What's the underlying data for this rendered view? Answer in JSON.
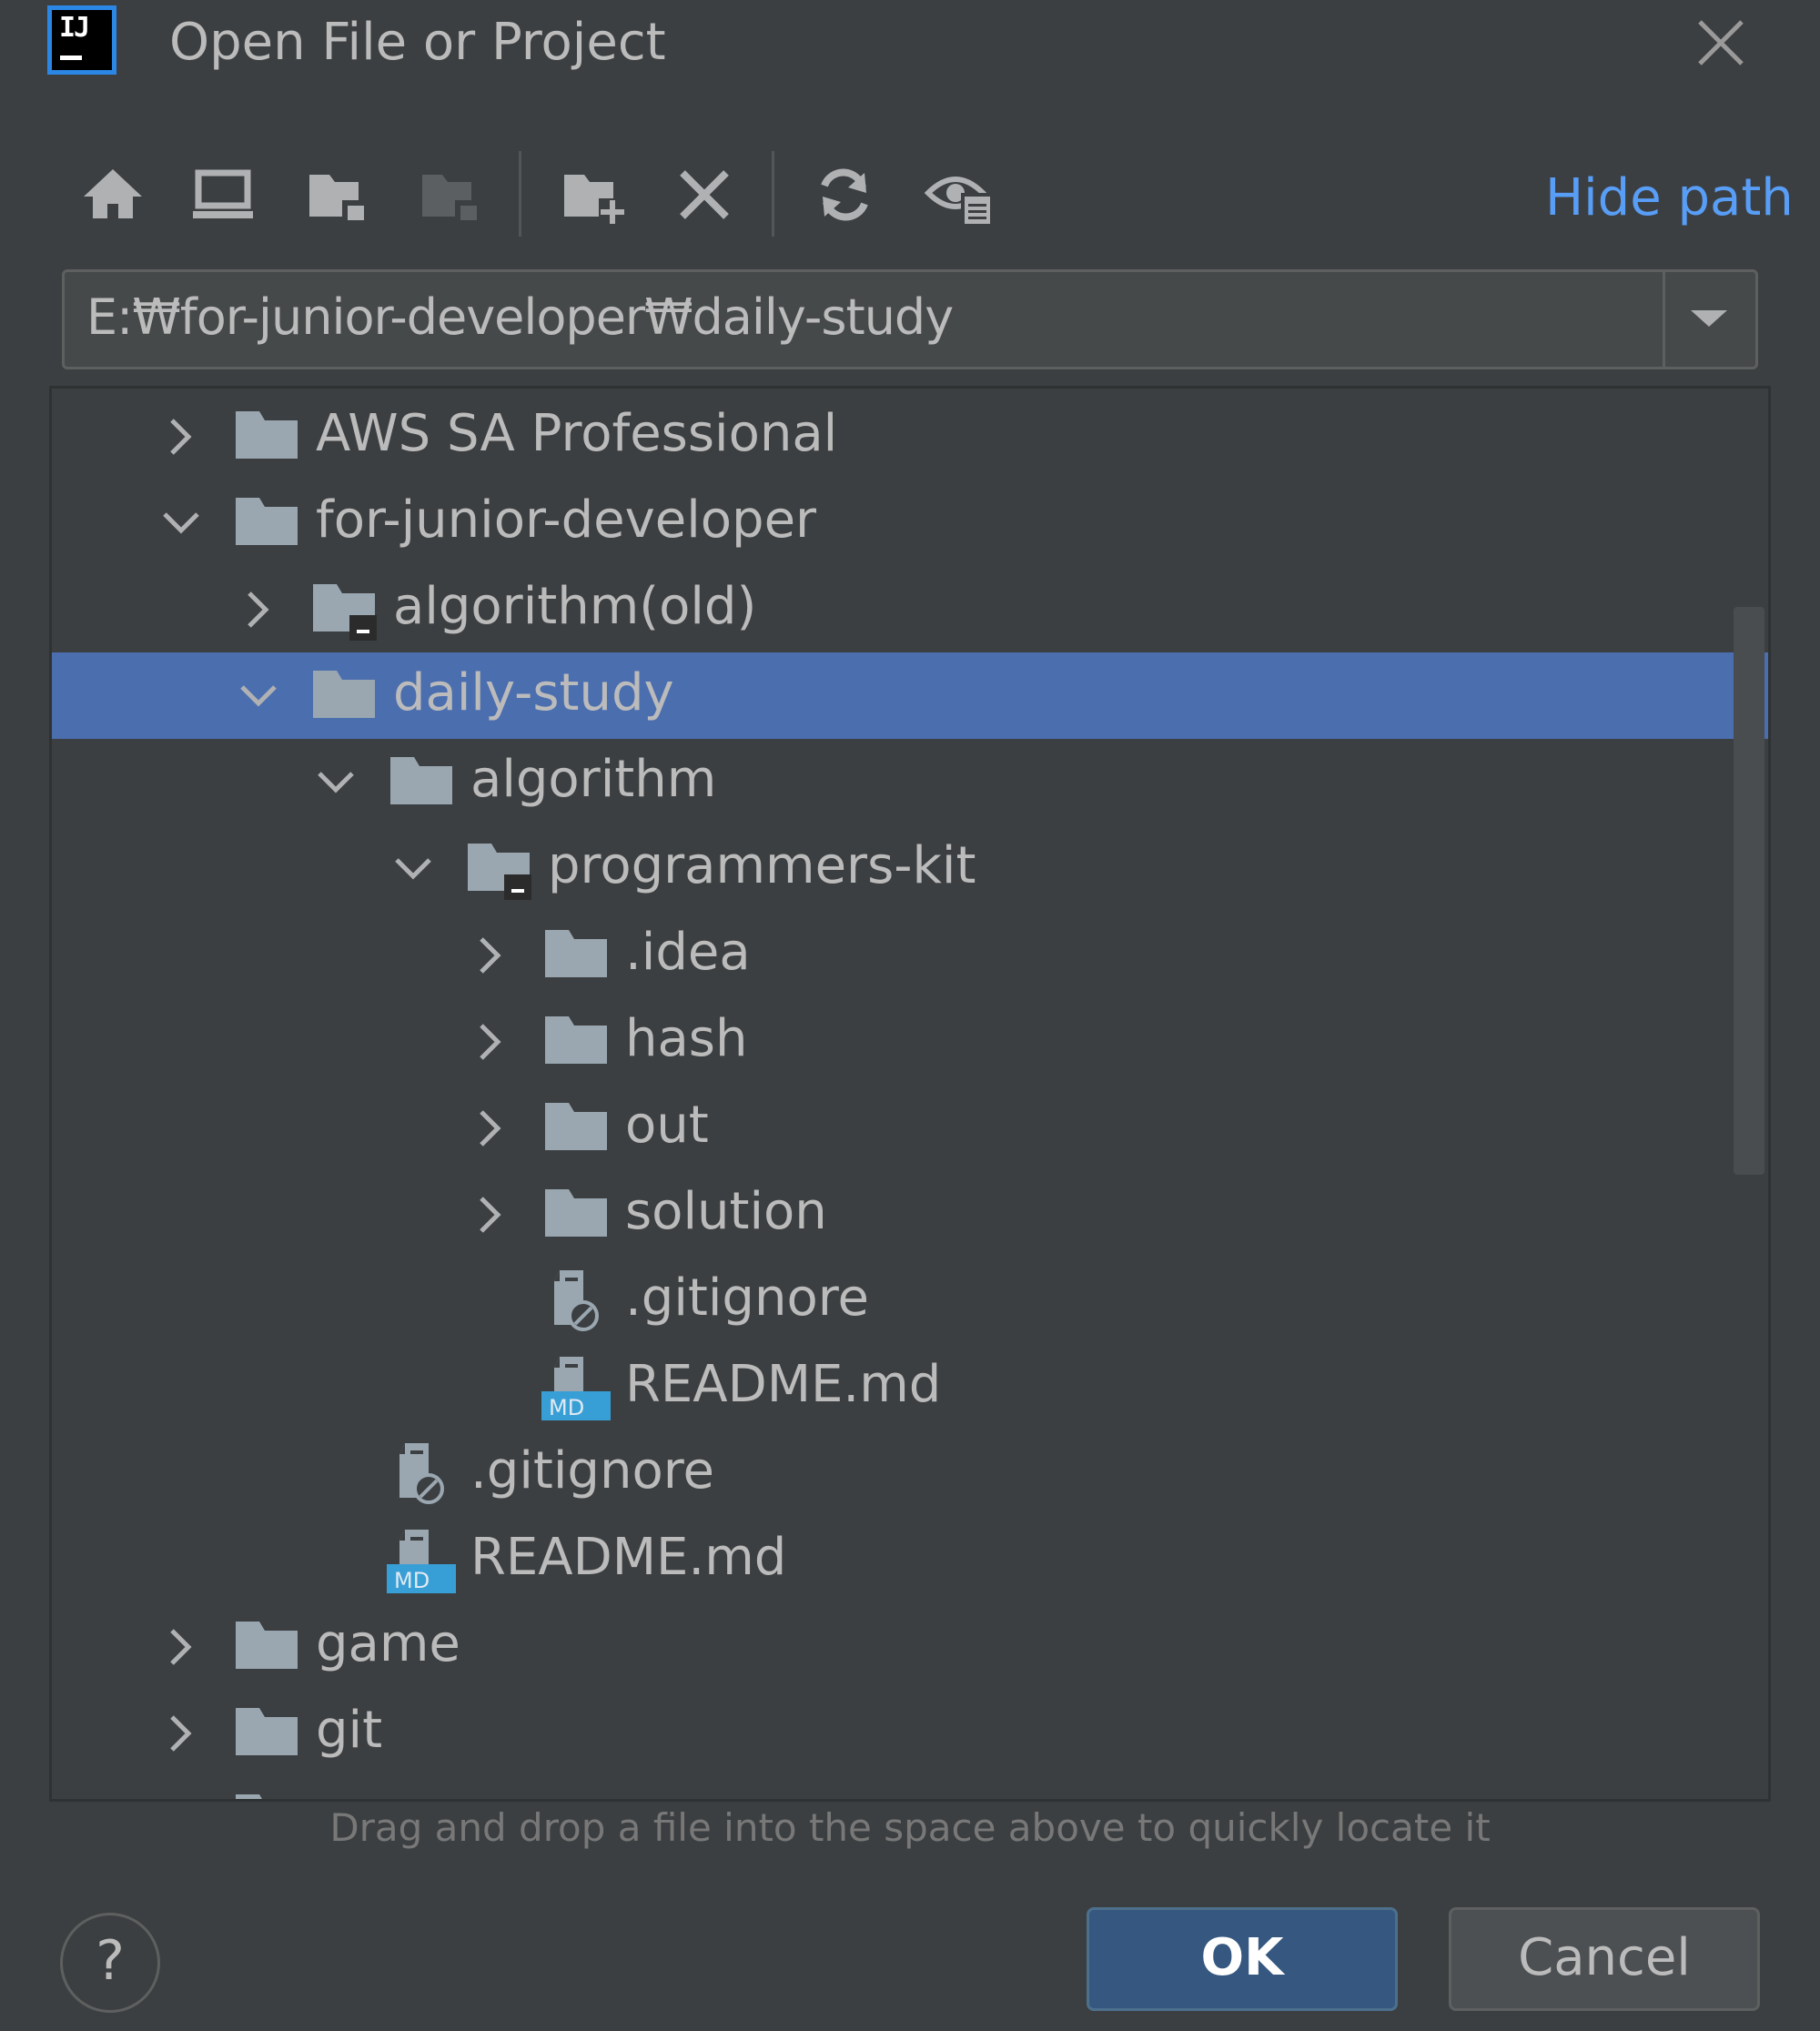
{
  "window": {
    "title": "Open File or Project",
    "logo_text": "IJ"
  },
  "toolbar": {
    "buttons": [
      {
        "icon": "home-icon",
        "name": "home-directory-button"
      },
      {
        "icon": "desktop-icon",
        "name": "desktop-directory-button"
      },
      {
        "icon": "project-folder-icon",
        "name": "project-directory-button"
      },
      {
        "icon": "module-folder-icon",
        "name": "module-directory-button",
        "disabled": true
      },
      {
        "icon": "new-folder-icon",
        "name": "new-folder-button"
      },
      {
        "icon": "delete-icon",
        "name": "delete-button"
      },
      {
        "icon": "refresh-icon",
        "name": "refresh-button"
      },
      {
        "icon": "show-hidden-files-icon",
        "name": "show-hidden-files-button"
      }
    ],
    "hide_path_label": "Hide path"
  },
  "path": {
    "value": "E:₩for-junior-developer₩daily-study"
  },
  "tree": {
    "items": [
      {
        "label": "AWS SA Professional",
        "depth": 0,
        "expander": "collapsed",
        "icon": "folder-icon"
      },
      {
        "label": "for-junior-developer",
        "depth": 0,
        "expander": "expanded",
        "icon": "folder-icon"
      },
      {
        "label": "algorithm(old)",
        "depth": 1,
        "expander": "collapsed",
        "icon": "project-folder-icon"
      },
      {
        "label": "daily-study",
        "depth": 1,
        "expander": "expanded",
        "icon": "folder-icon",
        "selected": true
      },
      {
        "label": "algorithm",
        "depth": 2,
        "expander": "expanded",
        "icon": "folder-icon"
      },
      {
        "label": "programmers-kit",
        "depth": 3,
        "expander": "expanded",
        "icon": "project-folder-icon"
      },
      {
        "label": ".idea",
        "depth": 4,
        "expander": "collapsed",
        "icon": "folder-icon"
      },
      {
        "label": "hash",
        "depth": 4,
        "expander": "collapsed",
        "icon": "folder-icon"
      },
      {
        "label": "out",
        "depth": 4,
        "expander": "collapsed",
        "icon": "folder-icon"
      },
      {
        "label": "solution",
        "depth": 4,
        "expander": "collapsed",
        "icon": "folder-icon"
      },
      {
        "label": ".gitignore",
        "depth": 4,
        "expander": "none",
        "icon": "ignore-file-icon"
      },
      {
        "label": "README.md",
        "depth": 4,
        "expander": "none",
        "icon": "markdown-file-icon",
        "badge": "MD"
      },
      {
        "label": ".gitignore",
        "depth": 2,
        "expander": "none",
        "icon": "ignore-file-icon"
      },
      {
        "label": "README.md",
        "depth": 2,
        "expander": "none",
        "icon": "markdown-file-icon",
        "badge": "MD"
      },
      {
        "label": "game",
        "depth": 0,
        "expander": "collapsed",
        "icon": "folder-icon"
      },
      {
        "label": "git",
        "depth": 0,
        "expander": "collapsed",
        "icon": "folder-icon"
      },
      {
        "label": "",
        "depth": 0,
        "expander": "collapsed",
        "icon": "folder-icon"
      }
    ]
  },
  "hint": "Drag and drop a file into the space above to quickly locate it",
  "buttons": {
    "help_label": "?",
    "ok_label": "OK",
    "cancel_label": "Cancel"
  },
  "colors": {
    "background": "#3c3f41",
    "selection": "#4b6eaf",
    "link": "#589df6",
    "icon": "#9aa7b0",
    "markdown_badge": "#389fd6"
  }
}
